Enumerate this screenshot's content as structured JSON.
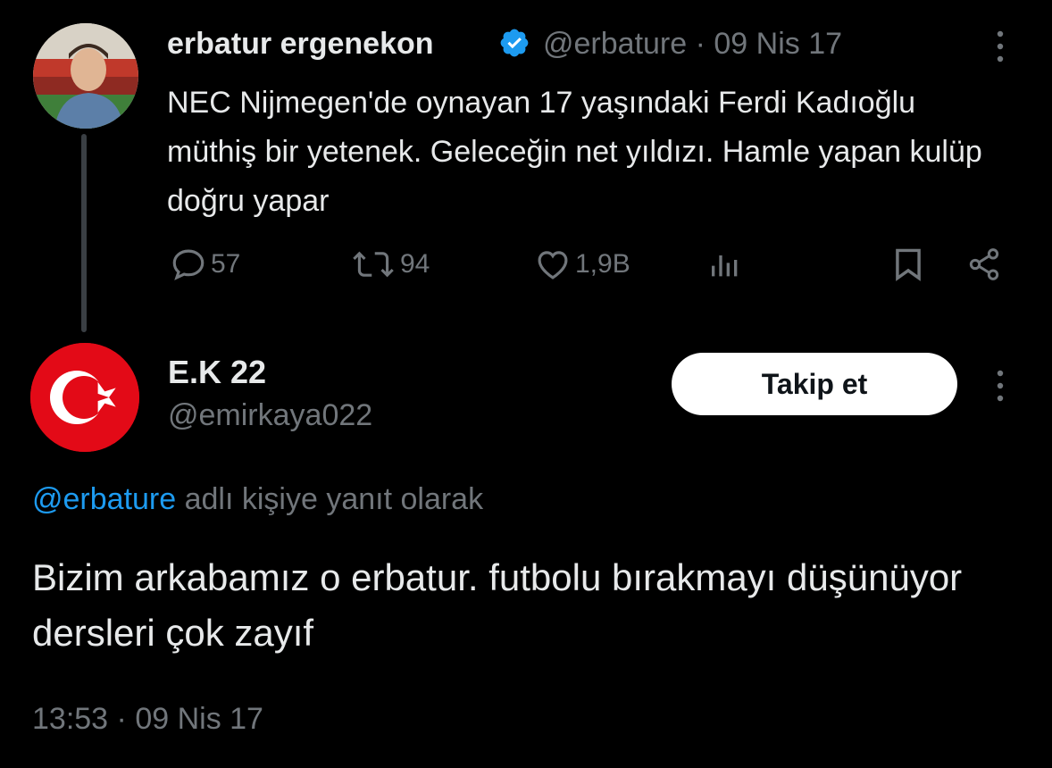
{
  "original_tweet": {
    "author_name": "erbatur ergenekon",
    "verified_icon": "verified-badge-icon",
    "handle": "@erbature",
    "separator": "·",
    "date": "09 Nis 17",
    "text": "NEC Nijmegen'de oynayan 17 yaşındaki Ferdi Kadıoğlu müthiş bir yetenek. Geleceğin net yıldızı. Hamle yapan kulüp doğru yapar",
    "actions": {
      "replies": "57",
      "retweets": "94",
      "likes": "1,9B"
    }
  },
  "reply_tweet": {
    "author_name": "E.K 22",
    "handle": "@emirkaya022",
    "follow_label": "Takip et",
    "reply_to_mention": "@erbature",
    "reply_to_suffix": " adlı kişiye yanıt olarak",
    "text": "Bizim arkabamız o erbatur. futbolu bırakmayı düşünüyor dersleri çok zayıf",
    "time": "13:53",
    "separator": "·",
    "date": "09 Nis 17"
  },
  "colors": {
    "background": "#000000",
    "text": "#e7e9ea",
    "muted": "#71767b",
    "accent": "#1d9bf0",
    "flag_red": "#e30a17"
  }
}
